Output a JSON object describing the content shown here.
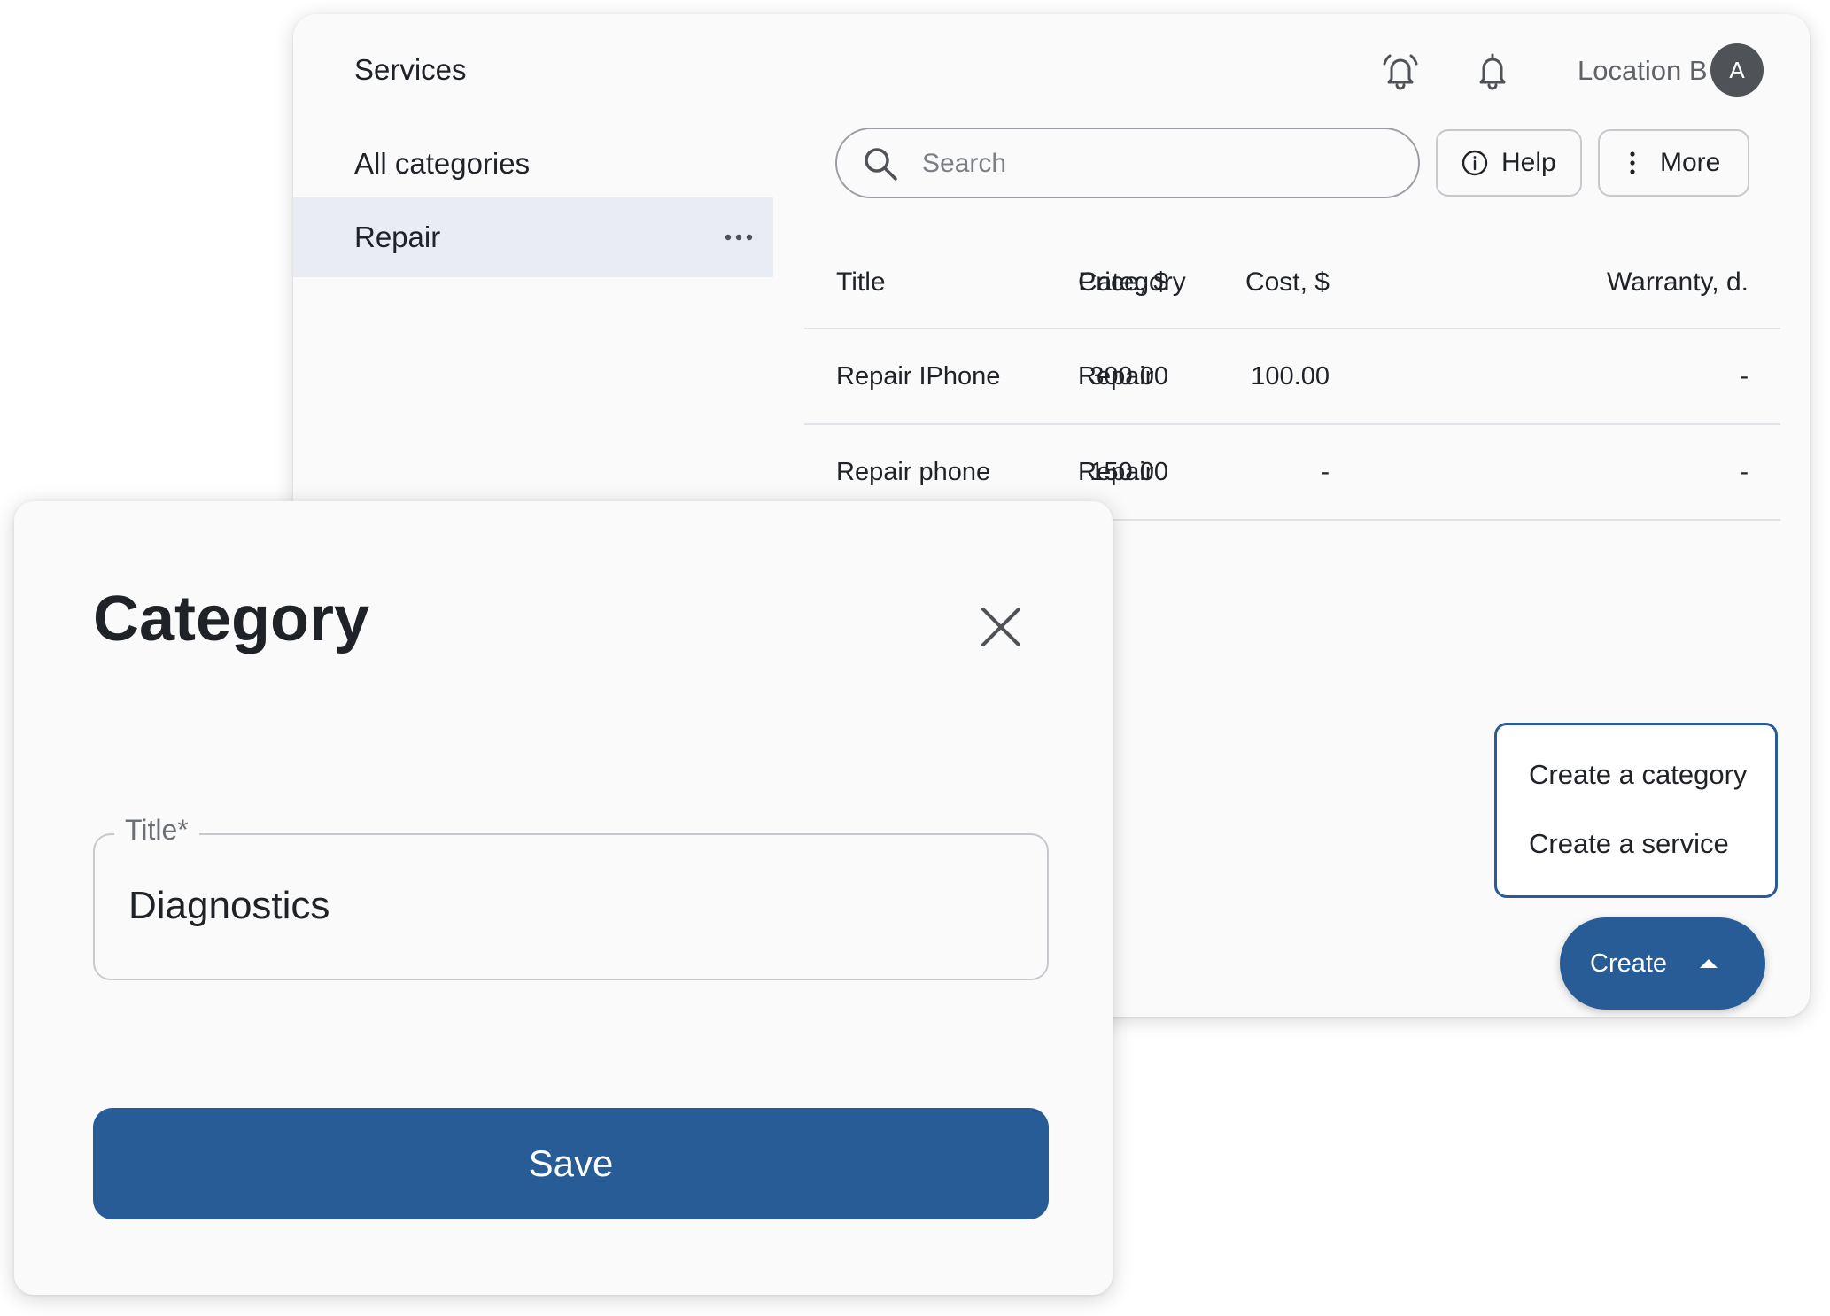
{
  "app": {
    "title": "Services",
    "location": "Location B",
    "avatar_initial": "A",
    "icons": {
      "alarm": "alarm-bell-icon",
      "notifications": "bell-icon"
    }
  },
  "sidebar": {
    "all_label": "All categories",
    "items": [
      {
        "label": "Repair",
        "selected": true,
        "menu_icon": "more-horizontal-icon"
      }
    ]
  },
  "toolbar": {
    "search_placeholder": "Search",
    "help_label": "Help",
    "more_label": "More"
  },
  "table": {
    "columns": [
      "Title",
      "Category",
      "Price, $",
      "Cost, $",
      "Warranty, d."
    ],
    "rows": [
      [
        "Repair IPhone",
        "Repair",
        "300.00",
        "100.00",
        "-"
      ],
      [
        "Repair phone",
        "Repair",
        "150.00",
        "-",
        "-"
      ]
    ]
  },
  "create_menu": {
    "items": [
      "Create a category",
      "Create a service"
    ],
    "button_label": "Create"
  },
  "dialog": {
    "title": "Category",
    "field_label": "Title",
    "required_mark": "*",
    "field_value": "Diagnostics",
    "save_label": "Save"
  },
  "colors": {
    "accent": "#285c97",
    "selected_bg": "#e9edf3",
    "panel_bg": "#fafafa"
  }
}
